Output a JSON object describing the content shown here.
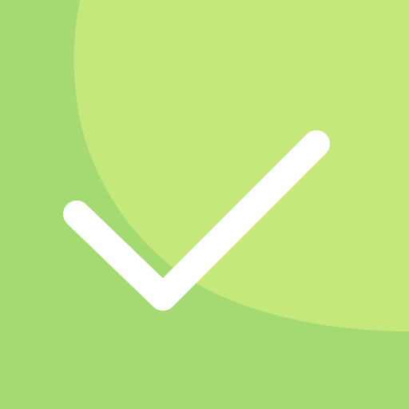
{
  "icon": {
    "name": "checkmark-icon",
    "colors": {
      "background": "#a5d972",
      "blob": "#c5e87b",
      "checkmark": "#ffffff"
    }
  }
}
